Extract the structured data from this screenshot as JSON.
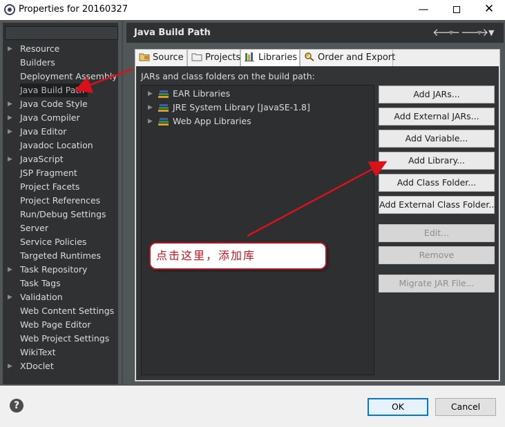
{
  "window": {
    "title": "Properties for 20160327",
    "minimize": "—",
    "close": "✕"
  },
  "sidebar": {
    "filter_value": "",
    "items": [
      {
        "label": "Resource",
        "expandable": true
      },
      {
        "label": "Builders",
        "expandable": false
      },
      {
        "label": "Deployment Assembly",
        "expandable": false
      },
      {
        "label": "Java Build Path",
        "expandable": false,
        "selected": true
      },
      {
        "label": "Java Code Style",
        "expandable": true
      },
      {
        "label": "Java Compiler",
        "expandable": true
      },
      {
        "label": "Java Editor",
        "expandable": true
      },
      {
        "label": "Javadoc Location",
        "expandable": false
      },
      {
        "label": "JavaScript",
        "expandable": true
      },
      {
        "label": "JSP Fragment",
        "expandable": false
      },
      {
        "label": "Project Facets",
        "expandable": false
      },
      {
        "label": "Project References",
        "expandable": false
      },
      {
        "label": "Run/Debug Settings",
        "expandable": false
      },
      {
        "label": "Server",
        "expandable": false
      },
      {
        "label": "Service Policies",
        "expandable": false
      },
      {
        "label": "Targeted Runtimes",
        "expandable": false
      },
      {
        "label": "Task Repository",
        "expandable": true
      },
      {
        "label": "Task Tags",
        "expandable": false
      },
      {
        "label": "Validation",
        "expandable": true
      },
      {
        "label": "Web Content Settings",
        "expandable": false
      },
      {
        "label": "Web Page Editor",
        "expandable": false
      },
      {
        "label": "Web Project Settings",
        "expandable": false
      },
      {
        "label": "WikiText",
        "expandable": false
      },
      {
        "label": "XDoclet",
        "expandable": true
      }
    ]
  },
  "page": {
    "title": "Java Build Path",
    "nav_back_icon": "arrow-left-icon",
    "nav_forward_icon": "arrow-right-icon",
    "nav_menu_icon": "triangle-down-icon"
  },
  "tabs": [
    {
      "label": "Source",
      "icon": "folder-source-icon"
    },
    {
      "label": "Projects",
      "icon": "folder-projects-icon"
    },
    {
      "label": "Libraries",
      "icon": "books-icon",
      "active": true
    },
    {
      "label": "Order and Export",
      "icon": "order-export-icon"
    }
  ],
  "libraries": {
    "caption": "JARs and class folders on the build path:",
    "entries": [
      {
        "label": "EAR Libraries"
      },
      {
        "label": "JRE System Library [JavaSE-1.8]"
      },
      {
        "label": "Web App Libraries"
      }
    ],
    "buttons": [
      {
        "label": "Add JARs...",
        "enabled": true
      },
      {
        "label": "Add External JARs...",
        "enabled": true
      },
      {
        "label": "Add Variable...",
        "enabled": true
      },
      {
        "label": "Add Library...",
        "enabled": true
      },
      {
        "label": "Add Class Folder...",
        "enabled": true
      },
      {
        "label": "Add External Class Folder...",
        "enabled": true
      },
      {
        "label": "Edit...",
        "enabled": false
      },
      {
        "label": "Remove",
        "enabled": false
      },
      {
        "label": "Migrate JAR File...",
        "enabled": false
      }
    ]
  },
  "annotation": {
    "text": "点击这里，添加库",
    "color": "#d0121a"
  },
  "footer": {
    "help": "?",
    "ok": "OK",
    "cancel": "Cancel",
    "accent": "#0078d7"
  }
}
